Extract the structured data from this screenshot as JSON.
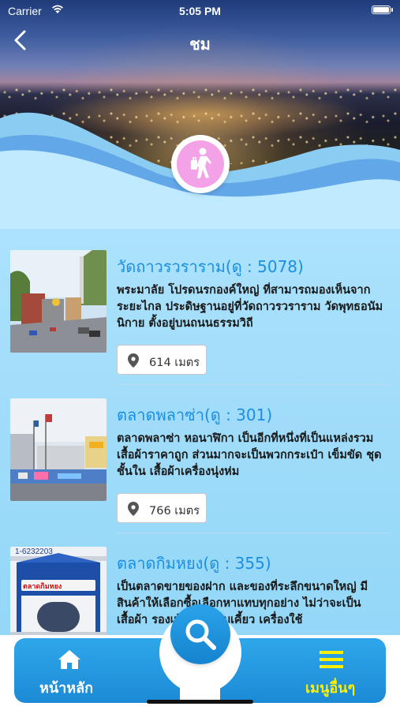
{
  "status": {
    "carrier": "Carrier",
    "time": "5:05 PM"
  },
  "nav": {
    "title": "ชม"
  },
  "items": [
    {
      "title": "วัดถาวรวราราม(ดู : 5078)",
      "description": "พระมาลัย โปรดนรกองค์ใหญ่  ที่สามารถมองเห็นจากระยะไกล  ประดิษฐานอยู่ที่วัดถาวรวราราม  วัดพุทธอนัมนิกาย  ตั้งอยู่บนถนนธรรมวิถี",
      "distance": "614 เมตร"
    },
    {
      "title": "ตลาดพลาซ่า(ดู : 301)",
      "description": "ตลาดพลาซ่า หอนาฬิกา เป็นอีกที่หนึ่งที่เป็นแหล่งรวมเสื้อผ้าราคาถูก ส่วนมากจะเป็นพวกกระเป๋า เข็มขัด ชุดชั้นใน เสื้อผ้าเครื่องนุ่งห่ม",
      "distance": "766 เมตร"
    },
    {
      "title": "ตลาดกิมหยง(ดู : 355)",
      "description": "เป็นตลาดขายของฝาก  และของที่ระลึกขนาดใหญ่  มีสินค้าให้เลือกซื้อเลือกหาแทบทุกอย่าง ไม่ว่าจะเป็นเสื้อผ้า  รองเท้า  ขนมขบเคี้ยว  เครื่องใช้",
      "distance": ""
    }
  ],
  "thumb_text": {
    "market_sign": "ตลาดกิมหยง",
    "phone_partial": "1-6232203"
  },
  "tabbar": {
    "home_label": "หน้าหลัก",
    "more_label": "เมนูอื่นๆ"
  },
  "colors": {
    "accent": "#1a8fe3",
    "tab_active": "#ffee00",
    "badge": "#f3a2e8"
  },
  "icons": {
    "back": "chevron-left-icon",
    "badge": "walking-traveler-icon",
    "pin": "map-pin-icon",
    "home": "home-icon",
    "search": "search-icon",
    "menu": "hamburger-menu-icon"
  }
}
